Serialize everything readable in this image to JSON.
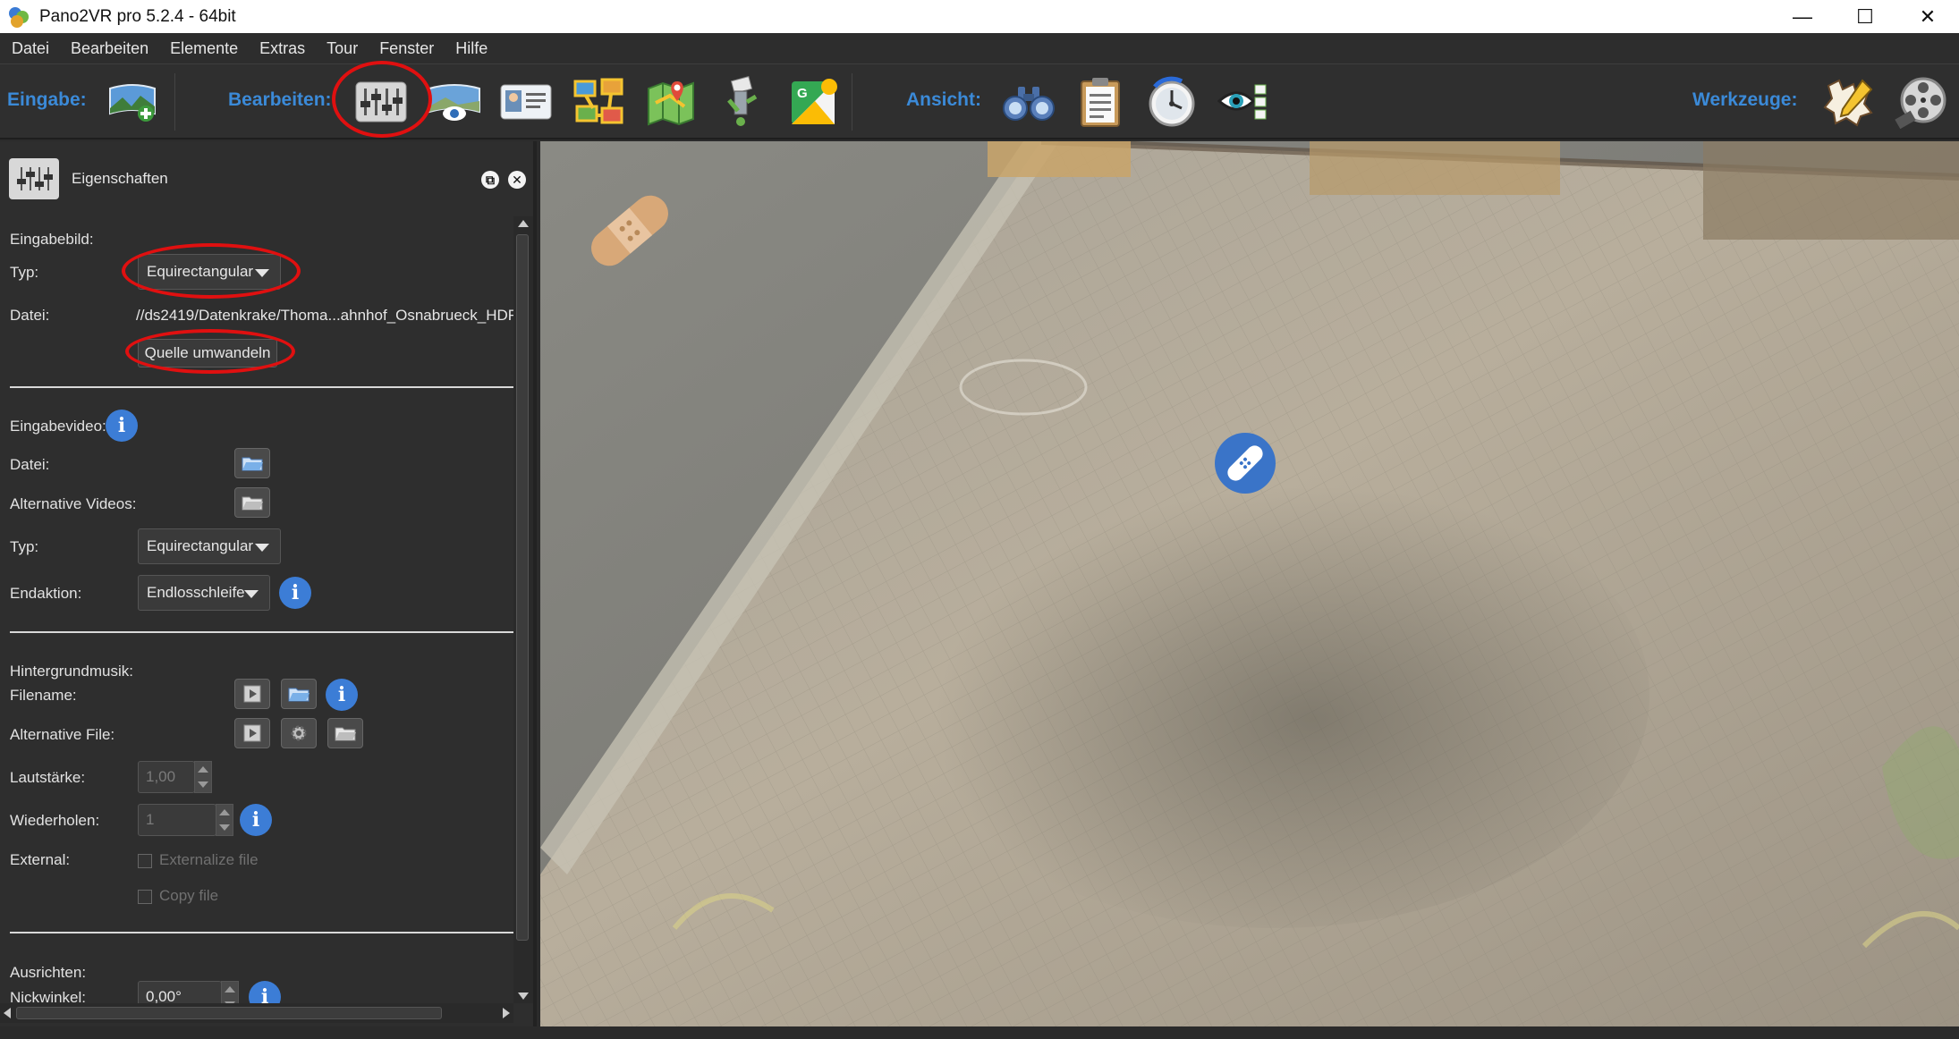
{
  "window": {
    "title": "Pano2VR pro 5.2.4 - 64bit",
    "controls": {
      "minimize": "—",
      "maximize": "☐",
      "close": "✕"
    }
  },
  "menubar": {
    "items": [
      "Datei",
      "Bearbeiten",
      "Elemente",
      "Extras",
      "Tour",
      "Fenster",
      "Hilfe"
    ]
  },
  "toolbar": {
    "input_label": "Eingabe:",
    "edit_label": "Bearbeiten:",
    "view_label": "Ansicht:",
    "tools_label": "Werkzeuge:",
    "icons": {
      "input": [
        "add-panorama-icon"
      ],
      "edit": [
        "properties-sliders-icon",
        "viewing-parameters-icon",
        "user-data-icon",
        "tour-map-icon",
        "map-pin-icon",
        "patch-icon",
        "google-street-view-icon"
      ],
      "view": [
        "binoculars-icon",
        "clipboard-icon",
        "compass-clock-icon",
        "eye-checklist-icon"
      ],
      "tools": [
        "skin-editor-icon",
        "film-reel-icon"
      ]
    }
  },
  "panel": {
    "title": "Eigenschaften",
    "input_image": {
      "heading": "Eingabebild:",
      "type_label": "Typ:",
      "type_value": "Equirectangular",
      "file_label": "Datei:",
      "file_value": "//ds2419/Datenkrake/Thoma...ahnhof_Osnabrueck_HDR.jpg",
      "convert_button": "Quelle umwandeln"
    },
    "input_video": {
      "heading": "Eingabevideo:",
      "file_label": "Datei:",
      "alt_label": "Alternative Videos:",
      "type_label": "Typ:",
      "type_value": "Equirectangular",
      "end_label": "Endaktion:",
      "end_value": "Endlosschleife"
    },
    "music": {
      "heading": "Hintergrundmusik:",
      "filename_label": "Filename:",
      "alt_label": "Alternative File:",
      "volume_label": "Lautstärke:",
      "volume_value": "1,00",
      "repeat_label": "Wiederholen:",
      "repeat_value": "1",
      "external_label": "External:",
      "externalize_label": "Externalize file",
      "copy_label": "Copy file"
    },
    "align": {
      "heading": "Ausrichten:",
      "tilt_label": "Nickwinkel:",
      "tilt_value": "0,00°"
    }
  },
  "colors": {
    "accent_blue": "#3b8ad8",
    "highlight_red": "#e01010",
    "panel_bg": "#2e2e2e"
  }
}
